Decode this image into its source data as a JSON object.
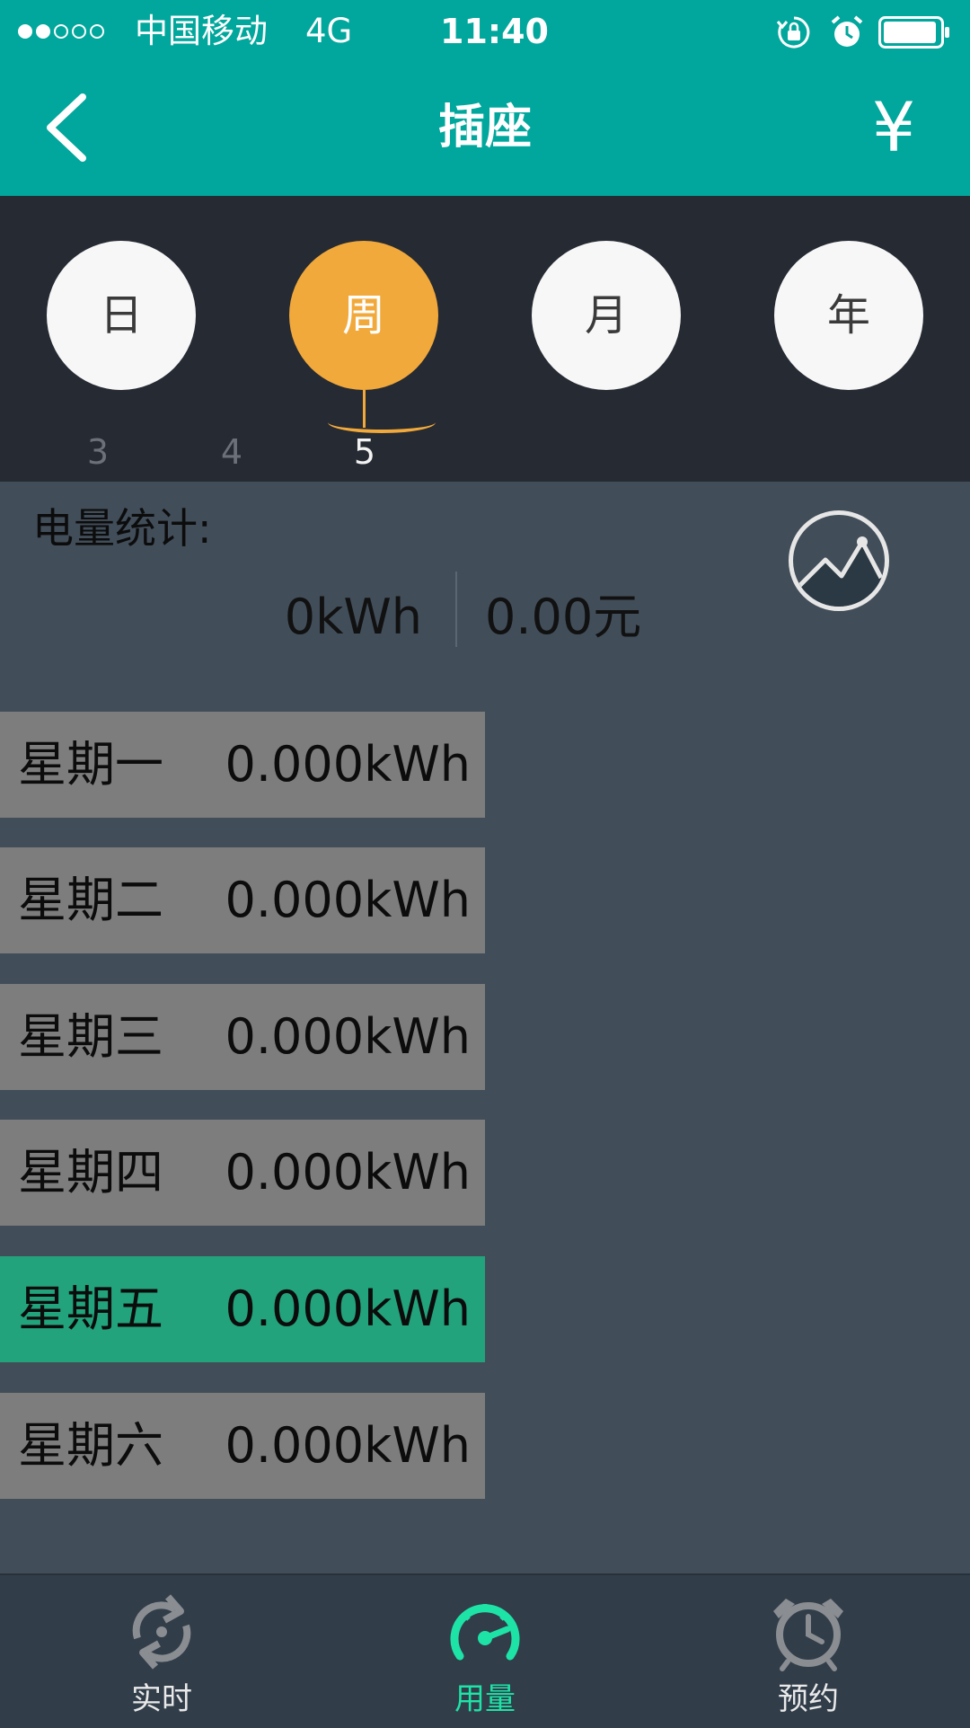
{
  "status_bar": {
    "signal_strength": "2/5",
    "carrier": "中国移动",
    "network": "4G",
    "time": "11:40",
    "icons": [
      "rotation-lock-icon",
      "alarm-icon",
      "battery-icon"
    ]
  },
  "nav": {
    "title": "插座",
    "back_icon": "chevron-left-icon",
    "right_icon_label": "¥"
  },
  "periods": [
    {
      "label": "日",
      "active": false
    },
    {
      "label": "周",
      "active": true
    },
    {
      "label": "月",
      "active": false
    },
    {
      "label": "年",
      "active": false
    }
  ],
  "weeks": [
    {
      "label": "3",
      "current": false
    },
    {
      "label": "4",
      "current": false
    },
    {
      "label": "5",
      "current": true
    }
  ],
  "stats": {
    "label": "电量统计:",
    "energy": "0kWh",
    "cost": "0.00元",
    "chart_icon": "line-chart-icon"
  },
  "days": [
    {
      "name": "星期一",
      "value": "0.000kWh",
      "today": false
    },
    {
      "name": "星期二",
      "value": "0.000kWh",
      "today": false
    },
    {
      "name": "星期三",
      "value": "0.000kWh",
      "today": false
    },
    {
      "name": "星期四",
      "value": "0.000kWh",
      "today": false
    },
    {
      "name": "星期五",
      "value": "0.000kWh",
      "today": true
    },
    {
      "name": "星期六",
      "value": "0.000kWh",
      "today": false
    }
  ],
  "tabs": [
    {
      "label": "实时",
      "icon": "refresh-icon",
      "active": false
    },
    {
      "label": "用量",
      "icon": "speedometer-icon",
      "active": true
    },
    {
      "label": "预约",
      "icon": "alarm-clock-icon",
      "active": false
    }
  ],
  "colors": {
    "header": "#01a79c",
    "period_active": "#f2a93b",
    "today_row": "#22a37c",
    "tab_active": "#1ee3a6"
  }
}
